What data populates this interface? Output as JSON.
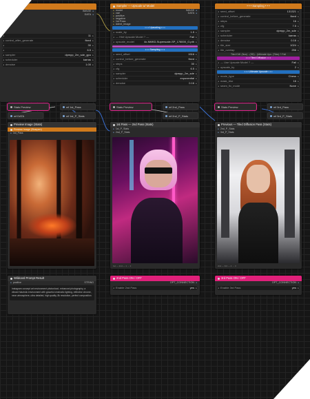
{
  "colors": {
    "pink": "#e0207a",
    "orange": "#d07a1c",
    "blue": "#2270c0",
    "purple": "#a020a0"
  },
  "left_widgets": {
    "rows": [
      {
        "label": "",
        "value": "11"
      },
      {
        "label": "control_after_generate",
        "value": "fixed"
      },
      {
        "label": "",
        "value": "30"
      },
      {
        "label": "",
        "value": "6.5"
      },
      {
        "label": "sampler",
        "value": "dpmpp_2m_sde_gpu"
      },
      {
        "label": "scheduler",
        "value": "karras"
      },
      {
        "label": "denoise",
        "value": "1.00"
      }
    ]
  },
  "left_title_io": {
    "out1": "IMAGE",
    "out2": "DATA"
  },
  "center_top": {
    "title": "Sampler — Upscale w/ Model",
    "io_left": [
      "model",
      "vae",
      "positive",
      "negative",
      "1st Pass",
      "latent_image"
    ],
    "io_right": [
      "IMAGE",
      "DATA"
    ],
    "widgets": [
      {
        "label": "scale_by",
        "value": "1.5"
      },
      {
        "label": "— Hint Upscale Model ? —",
        "value": "Fail"
      },
      {
        "label": "upscale_model",
        "value": "4x-NMKD-Superscale-SP_178000_G.pth"
      }
    ],
    "bar_upscaling": "• • • Upscaling • • •",
    "bar_sampling": "• • • Sampling • • •",
    "sampling_rows": [
      {
        "label": "seed_offset",
        "value": "1516"
      },
      {
        "label": "control_before_generate",
        "value": "fixed"
      },
      {
        "label": "steps",
        "value": "30"
      },
      {
        "label": "cfg",
        "value": "6.5"
      },
      {
        "label": "sampler",
        "value": "dpmpp_2m_sde"
      },
      {
        "label": "scheduler",
        "value": "exponential"
      },
      {
        "label": "denoise",
        "value": "0.16"
      }
    ]
  },
  "right_top": {
    "bar_sampling": "• • • Sampling • • •",
    "rows": [
      {
        "label": "seed_offset",
        "value": "131321"
      },
      {
        "label": "control_before_generate",
        "value": "fixed"
      },
      {
        "label": "steps",
        "value": "16"
      },
      {
        "label": "cfg",
        "value": "7.5"
      },
      {
        "label": "sampler",
        "value": "dpmpp_2m_sde"
      },
      {
        "label": "scheduler",
        "value": "karras"
      },
      {
        "label": "denoise",
        "value": "0.16"
      },
      {
        "label": "tile_size",
        "value": "1024"
      },
      {
        "label": "tile_overlap",
        "value": "256"
      }
    ],
    "tiled_text": "Tiled Diff. (Non) - (SD) - (Ultimate Ups. (Tiles) ?",
    "tiled_value": "Fail",
    "bar_tiled": "• • • Tiled Diffusion • • •",
    "hint_row": {
      "label": "— Use Upscale Model ? —",
      "value": "Fail"
    },
    "hint_row2": {
      "label": "upscale_by",
      "value": "2"
    },
    "bar_ultimate": "• • • Ultimate Upscale • • •",
    "ult_rows": [
      {
        "label": "mode_type",
        "value": "Chess"
      },
      {
        "label": "mask_blur",
        "value": "16"
      },
      {
        "label": "seam_fix_mode",
        "value": "None"
      }
    ]
  },
  "stats_rows": [
    {
      "label": "Stats Preview",
      "out": "wf 1st_Pass",
      "out2": "wf 1st_P_Stats",
      "inlabel": "wf DATA"
    },
    {
      "label": "Stats Preview",
      "out": "wf 2nd_Pass",
      "out2": "wf 2nd_P_Stats",
      "inlabel": ""
    },
    {
      "label": "Stats Preview",
      "out": "wf 3rd_Pass",
      "out2": "wf 3rd_P_Stats",
      "inlabel": ""
    }
  ],
  "preview_left": {
    "title": "Preview Image (Stats)",
    "bar": "Preview Image (Sharpen)",
    "input": "1st_Pass",
    "caption": ""
  },
  "preview_center": {
    "title": "1st Pass — 2nd Pass (Stats)",
    "inputs": [
      "1st_P_Stats",
      "2nd_P_Stats"
    ],
    "caption": "1st — 2nd — 1 → 2"
  },
  "preview_right": {
    "title": "Previous — Tiled Diffusion Pass (Stats)",
    "inputs": [
      "2nd_P_Stats",
      "3rd_P_Stats"
    ],
    "caption": "2nd — 3rd — 2 → 3"
  },
  "prompt_node": {
    "title": "Wildcard Prompt Result",
    "slot": "positive",
    "slot_type": "STRING",
    "text": "Instagram concept art environment photoshoot, enhanced photography, a vibrant futuristic environment with graceful cinematic lighting, reflective chrome, neon atmosphere, ultra detailed, high quality, 8k resolution, perfect composition"
  },
  "pass2": {
    "title": "2nd Pass ON / OFF",
    "out": "OPT_CONNECTION",
    "row_label": "Enable 2nd Pass",
    "row_value": "yes"
  },
  "pass3": {
    "title": "3rd Pass ON / OFF",
    "out": "OPT_CONNECTION",
    "row_label": "Enable 3rd Pass",
    "row_value": "yes"
  }
}
